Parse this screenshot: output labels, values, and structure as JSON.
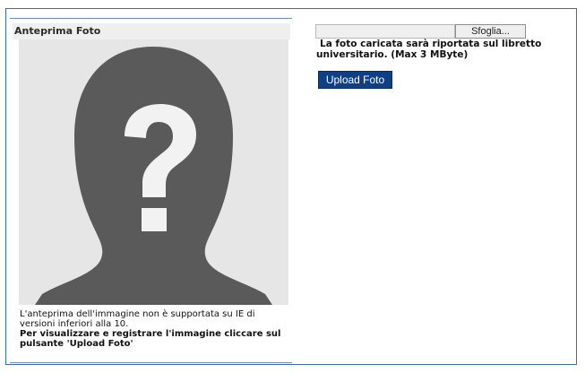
{
  "panel": {
    "title": "Anteprima Foto",
    "note_line1": "L'anteprima dell'immagine non è supportata su IE di versioni inferiori alla 10.",
    "note_bold": "Per visualizzare e registrare l'immagine cliccare sul pulsante 'Upload Foto'"
  },
  "file_input": {
    "browse_label": "Sfoglia..."
  },
  "upload": {
    "info": "La foto caricata sarà riportata sul libretto universitario. (Max 3 MByte)",
    "button_label": "Upload Foto"
  },
  "colors": {
    "frame_border": "#3a6ea5",
    "upload_button_bg": "#0f3f85",
    "silhouette": "#5a5a5a",
    "photo_bg": "#e6e6e6"
  },
  "icons": {
    "photo_placeholder": "unknown-person-icon"
  }
}
